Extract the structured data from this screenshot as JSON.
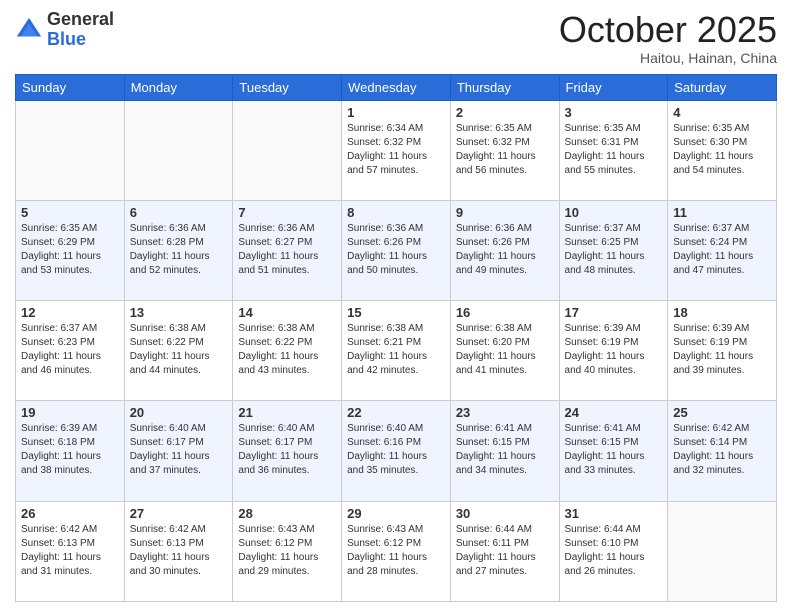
{
  "header": {
    "logo_general": "General",
    "logo_blue": "Blue",
    "month_title": "October 2025",
    "location": "Haitou, Hainan, China"
  },
  "days_of_week": [
    "Sunday",
    "Monday",
    "Tuesday",
    "Wednesday",
    "Thursday",
    "Friday",
    "Saturday"
  ],
  "weeks": [
    [
      {
        "day": "",
        "empty": true
      },
      {
        "day": "",
        "empty": true
      },
      {
        "day": "",
        "empty": true
      },
      {
        "day": "1",
        "sunrise": "6:34 AM",
        "sunset": "6:32 PM",
        "daylight": "11 hours and 57 minutes."
      },
      {
        "day": "2",
        "sunrise": "6:35 AM",
        "sunset": "6:32 PM",
        "daylight": "11 hours and 56 minutes."
      },
      {
        "day": "3",
        "sunrise": "6:35 AM",
        "sunset": "6:31 PM",
        "daylight": "11 hours and 55 minutes."
      },
      {
        "day": "4",
        "sunrise": "6:35 AM",
        "sunset": "6:30 PM",
        "daylight": "11 hours and 54 minutes."
      }
    ],
    [
      {
        "day": "5",
        "sunrise": "6:35 AM",
        "sunset": "6:29 PM",
        "daylight": "11 hours and 53 minutes."
      },
      {
        "day": "6",
        "sunrise": "6:36 AM",
        "sunset": "6:28 PM",
        "daylight": "11 hours and 52 minutes."
      },
      {
        "day": "7",
        "sunrise": "6:36 AM",
        "sunset": "6:27 PM",
        "daylight": "11 hours and 51 minutes."
      },
      {
        "day": "8",
        "sunrise": "6:36 AM",
        "sunset": "6:26 PM",
        "daylight": "11 hours and 50 minutes."
      },
      {
        "day": "9",
        "sunrise": "6:36 AM",
        "sunset": "6:26 PM",
        "daylight": "11 hours and 49 minutes."
      },
      {
        "day": "10",
        "sunrise": "6:37 AM",
        "sunset": "6:25 PM",
        "daylight": "11 hours and 48 minutes."
      },
      {
        "day": "11",
        "sunrise": "6:37 AM",
        "sunset": "6:24 PM",
        "daylight": "11 hours and 47 minutes."
      }
    ],
    [
      {
        "day": "12",
        "sunrise": "6:37 AM",
        "sunset": "6:23 PM",
        "daylight": "11 hours and 46 minutes."
      },
      {
        "day": "13",
        "sunrise": "6:38 AM",
        "sunset": "6:22 PM",
        "daylight": "11 hours and 44 minutes."
      },
      {
        "day": "14",
        "sunrise": "6:38 AM",
        "sunset": "6:22 PM",
        "daylight": "11 hours and 43 minutes."
      },
      {
        "day": "15",
        "sunrise": "6:38 AM",
        "sunset": "6:21 PM",
        "daylight": "11 hours and 42 minutes."
      },
      {
        "day": "16",
        "sunrise": "6:38 AM",
        "sunset": "6:20 PM",
        "daylight": "11 hours and 41 minutes."
      },
      {
        "day": "17",
        "sunrise": "6:39 AM",
        "sunset": "6:19 PM",
        "daylight": "11 hours and 40 minutes."
      },
      {
        "day": "18",
        "sunrise": "6:39 AM",
        "sunset": "6:19 PM",
        "daylight": "11 hours and 39 minutes."
      }
    ],
    [
      {
        "day": "19",
        "sunrise": "6:39 AM",
        "sunset": "6:18 PM",
        "daylight": "11 hours and 38 minutes."
      },
      {
        "day": "20",
        "sunrise": "6:40 AM",
        "sunset": "6:17 PM",
        "daylight": "11 hours and 37 minutes."
      },
      {
        "day": "21",
        "sunrise": "6:40 AM",
        "sunset": "6:17 PM",
        "daylight": "11 hours and 36 minutes."
      },
      {
        "day": "22",
        "sunrise": "6:40 AM",
        "sunset": "6:16 PM",
        "daylight": "11 hours and 35 minutes."
      },
      {
        "day": "23",
        "sunrise": "6:41 AM",
        "sunset": "6:15 PM",
        "daylight": "11 hours and 34 minutes."
      },
      {
        "day": "24",
        "sunrise": "6:41 AM",
        "sunset": "6:15 PM",
        "daylight": "11 hours and 33 minutes."
      },
      {
        "day": "25",
        "sunrise": "6:42 AM",
        "sunset": "6:14 PM",
        "daylight": "11 hours and 32 minutes."
      }
    ],
    [
      {
        "day": "26",
        "sunrise": "6:42 AM",
        "sunset": "6:13 PM",
        "daylight": "11 hours and 31 minutes."
      },
      {
        "day": "27",
        "sunrise": "6:42 AM",
        "sunset": "6:13 PM",
        "daylight": "11 hours and 30 minutes."
      },
      {
        "day": "28",
        "sunrise": "6:43 AM",
        "sunset": "6:12 PM",
        "daylight": "11 hours and 29 minutes."
      },
      {
        "day": "29",
        "sunrise": "6:43 AM",
        "sunset": "6:12 PM",
        "daylight": "11 hours and 28 minutes."
      },
      {
        "day": "30",
        "sunrise": "6:44 AM",
        "sunset": "6:11 PM",
        "daylight": "11 hours and 27 minutes."
      },
      {
        "day": "31",
        "sunrise": "6:44 AM",
        "sunset": "6:10 PM",
        "daylight": "11 hours and 26 minutes."
      },
      {
        "day": "",
        "empty": true
      }
    ]
  ],
  "labels": {
    "sunrise": "Sunrise:",
    "sunset": "Sunset:",
    "daylight": "Daylight:"
  }
}
